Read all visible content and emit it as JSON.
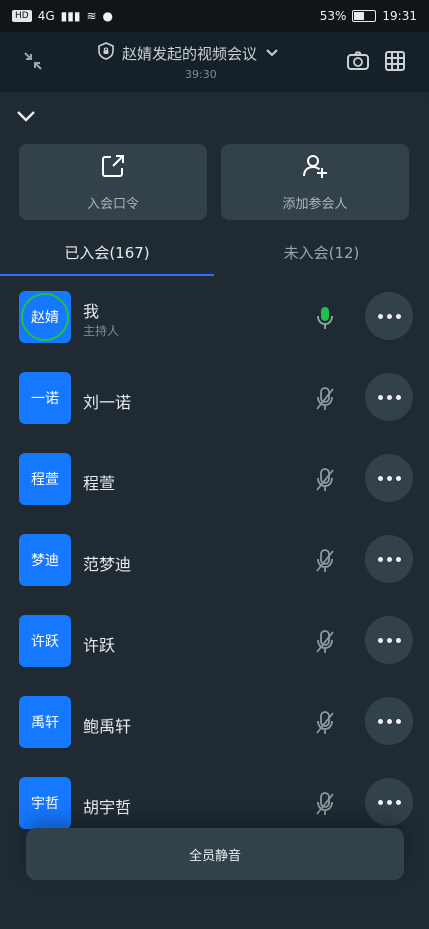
{
  "status": {
    "left": [
      "HD",
      "4G"
    ],
    "battery": "53%",
    "time": "19:31"
  },
  "meeting": {
    "title": "赵婧发起的视频会议",
    "timer": "39:30"
  },
  "actions": [
    {
      "label": "入会口令"
    },
    {
      "label": "添加参会人"
    }
  ],
  "tabs": [
    {
      "label": "已入会(167)"
    },
    {
      "label": "未入会(12)"
    }
  ],
  "participants": [
    {
      "avatar_text": "赵婧",
      "name": "我",
      "subtitle": "主持人",
      "mic_state": "on"
    },
    {
      "avatar_text": "一诺",
      "name": "刘一诺",
      "subtitle": "",
      "mic_state": "muted"
    },
    {
      "avatar_text": "程萱",
      "name": "程萱",
      "subtitle": "",
      "mic_state": "muted"
    },
    {
      "avatar_text": "梦迪",
      "name": "范梦迪",
      "subtitle": "",
      "mic_state": "muted"
    },
    {
      "avatar_text": "许跃",
      "name": "许跃",
      "subtitle": "",
      "mic_state": "muted"
    },
    {
      "avatar_text": "禹轩",
      "name": "鲍禹轩",
      "subtitle": "",
      "mic_state": "muted"
    },
    {
      "avatar_text": "宇哲",
      "name": "胡宇哲",
      "subtitle": "",
      "mic_state": "muted"
    }
  ],
  "footer": {
    "mute_all_label": "全员静音"
  },
  "colors": {
    "accent": "#1677ff",
    "tab_underline": "#2f6fff",
    "mic_on": "#1fbf4a"
  }
}
